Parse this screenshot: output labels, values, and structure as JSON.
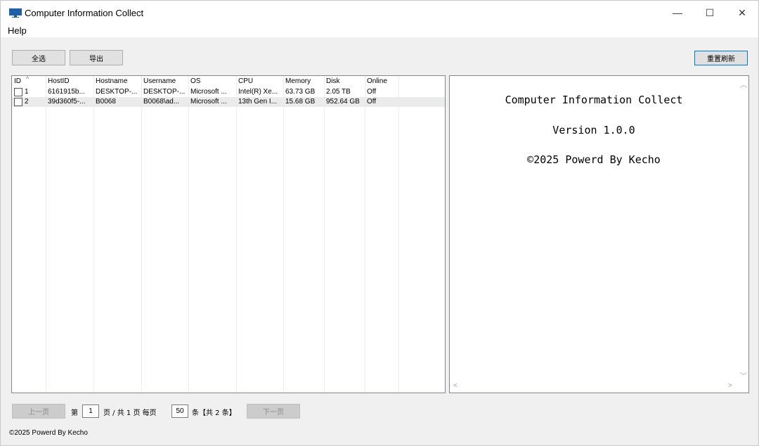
{
  "window": {
    "title": "Computer Information Collect",
    "minimize_label": "—",
    "maximize_label": "☐",
    "close_label": "✕"
  },
  "menu": {
    "help": "Help"
  },
  "toolbar": {
    "select_all": "全选",
    "export": "导出",
    "refresh": "重置刷新"
  },
  "table": {
    "columns": [
      "ID",
      "HostID",
      "Hostname",
      "Username",
      "OS",
      "CPU",
      "Memory",
      "Disk",
      "Online"
    ],
    "rows": [
      {
        "id": "1",
        "hostid": "6161915b...",
        "hostname": "DESKTOP-...",
        "username": "DESKTOP-...",
        "os": "Microsoft ...",
        "cpu": "Intel(R) Xe...",
        "memory": "63.73 GB",
        "disk": "2.05 TB",
        "online": "Off"
      },
      {
        "id": "2",
        "hostid": "39d360f5-...",
        "hostname": "B0068",
        "username": "B0068\\ad...",
        "os": "Microsoft ...",
        "cpu": "13th Gen I...",
        "memory": "15.68 GB",
        "disk": "952.64 GB",
        "online": "Off"
      }
    ]
  },
  "info": {
    "title": "Computer Information Collect",
    "version": "Version 1.0.0",
    "copyright": "©2025 Powerd By Kecho"
  },
  "pager": {
    "prev": "上一页",
    "page_prefix": "第",
    "page_value": "1",
    "page_mid": "页 / 共 1 页 每页",
    "page_size": "50",
    "count_text": "条【共 2 条】",
    "next": "下一页"
  },
  "status": {
    "text": "©2025 Powerd By Kecho"
  },
  "colors": {
    "accent": "#0078d7",
    "window_bg": "#f0f0f0",
    "row_alt": "#ebebeb"
  }
}
